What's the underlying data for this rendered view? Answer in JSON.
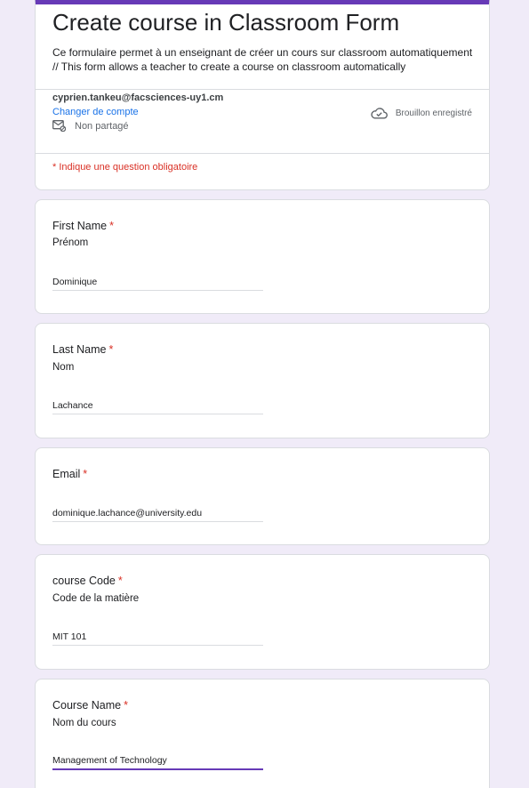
{
  "form": {
    "title": "Create course in Classroom Form",
    "description_line1": "Ce formulaire permet à un enseignant de créer un cours sur classroom automatiquement",
    "description_line2": "// This form allows a teacher to create a course on classroom automatically",
    "accent_color": "#673ab7",
    "background_color": "#f0ebf8"
  },
  "account": {
    "email": "cyprien.tankeu@facsciences-uy1.cm",
    "switch_label": "Changer de compte",
    "not_shared_label": "Non partagé",
    "draft_status": "Brouillon enregistré"
  },
  "required_note": "* Indique une question obligatoire",
  "questions": [
    {
      "label": "First Name",
      "required_mark": "*",
      "subtitle": "Prénom",
      "value": "Dominique"
    },
    {
      "label": "Last Name",
      "required_mark": "*",
      "subtitle": "Nom",
      "value": "Lachance"
    },
    {
      "label": "Email",
      "required_mark": "*",
      "subtitle": "",
      "value": "dominique.lachance@university.edu"
    },
    {
      "label": "course Code",
      "required_mark": "*",
      "subtitle": "Code de la matière",
      "value": "MIT 101"
    },
    {
      "label": "Course Name",
      "required_mark": "*",
      "subtitle": "Nom du cours",
      "value": "Management of Technology"
    }
  ]
}
